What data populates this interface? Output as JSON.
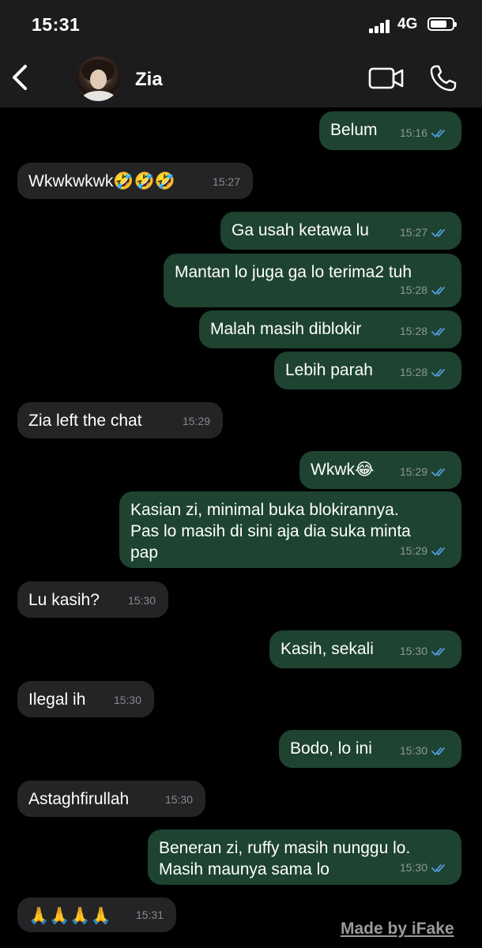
{
  "status_bar": {
    "time": "15:31",
    "network": "4G"
  },
  "header": {
    "contact_name": "Zia"
  },
  "messages": [
    {
      "dir": "out",
      "text": "Belum",
      "time": "15:16"
    },
    {
      "dir": "in",
      "text": "Wkwkwkwk🤣🤣🤣",
      "time": "15:27"
    },
    {
      "dir": "out",
      "text": "Ga usah ketawa lu",
      "time": "15:27"
    },
    {
      "dir": "out",
      "text": "Mantan lo juga ga lo terima2 tuh",
      "time": "15:28"
    },
    {
      "dir": "out",
      "text": "Malah masih diblokir",
      "time": "15:28"
    },
    {
      "dir": "out",
      "text": "Lebih parah",
      "time": "15:28"
    },
    {
      "dir": "in",
      "text": "Zia left the chat",
      "time": "15:29"
    },
    {
      "dir": "out",
      "text": "Wkwk😂",
      "time": "15:29"
    },
    {
      "dir": "out",
      "text": "Kasian zi, minimal buka blokirannya.\nPas lo masih di sini aja dia suka minta\npap",
      "time": "15:29"
    },
    {
      "dir": "in",
      "text": "Lu kasih?",
      "time": "15:30"
    },
    {
      "dir": "out",
      "text": "Kasih, sekali",
      "time": "15:30"
    },
    {
      "dir": "in",
      "text": "Ilegal ih",
      "time": "15:30"
    },
    {
      "dir": "out",
      "text": "Bodo, lo ini",
      "time": "15:30"
    },
    {
      "dir": "in",
      "text": "Astaghfirullah",
      "time": "15:30"
    },
    {
      "dir": "out",
      "text": "Beneran zi, ruffy masih nunggu lo.\nMasih maunya sama lo",
      "time": "15:30"
    },
    {
      "dir": "in",
      "text": "🙏🙏🙏🙏",
      "time": "15:31"
    }
  ],
  "watermark": "Made by iFake",
  "colors": {
    "background": "#000000",
    "bar": "#1c1c1e",
    "incoming_bubble": "#242426",
    "outgoing_bubble": "#1e4331",
    "read_ticks": "#4f9bd9"
  },
  "icons": {
    "back": "chevron-left-icon",
    "video": "video-camera-icon",
    "call": "phone-icon",
    "read": "double-check-icon"
  }
}
